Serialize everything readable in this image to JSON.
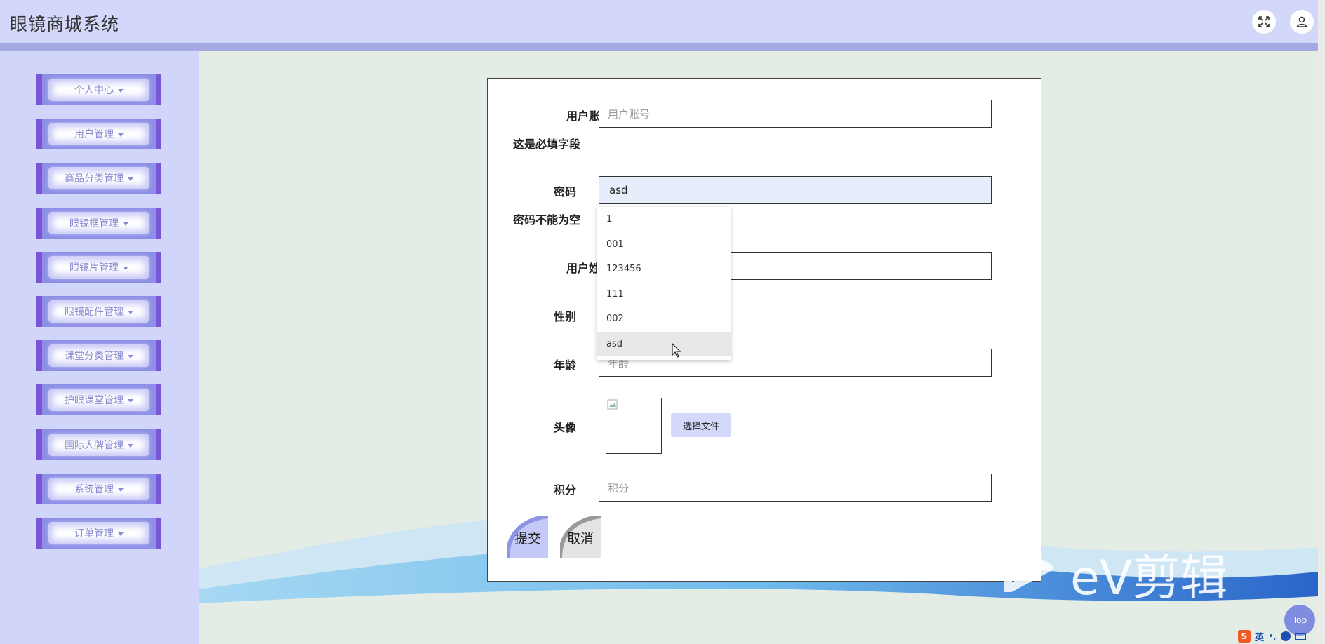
{
  "header": {
    "title": "眼镜商城系统"
  },
  "sidebar": {
    "items": [
      {
        "label": "个人中心"
      },
      {
        "label": "用户管理"
      },
      {
        "label": "商品分类管理"
      },
      {
        "label": "眼镜框管理"
      },
      {
        "label": "眼镜片管理"
      },
      {
        "label": "眼镜配件管理"
      },
      {
        "label": "课堂分类管理"
      },
      {
        "label": "护眼课堂管理"
      },
      {
        "label": "国际大牌管理"
      },
      {
        "label": "系统管理"
      },
      {
        "label": "订单管理"
      }
    ]
  },
  "form": {
    "account": {
      "label": "用户账号",
      "placeholder": "用户账号",
      "error": "这是必填字段"
    },
    "password": {
      "label": "密码",
      "value": "asd",
      "error": "密码不能为空"
    },
    "name": {
      "label": "用户姓名"
    },
    "gender": {
      "label": "性别"
    },
    "age": {
      "label": "年龄",
      "placeholder": "年龄"
    },
    "avatar": {
      "label": "头像",
      "file_button": "选择文件"
    },
    "points": {
      "label": "积分",
      "placeholder": "积分"
    },
    "submit_label": "提交",
    "cancel_label": "取消"
  },
  "autocomplete": {
    "options": [
      "1",
      "001",
      "123456",
      "111",
      "002",
      "asd"
    ],
    "selected_index": 5
  },
  "watermark": {
    "text": "eV剪辑"
  },
  "top_button": {
    "label": "Top"
  },
  "ime": {
    "lang": "英",
    "punct": "•,"
  },
  "colors": {
    "header_bg": "#d3d8fb",
    "sidebar_bg": "#d1d5f9",
    "menu_border": "#7a55d6",
    "accent": "#8a8cd2",
    "content_bg": "#e3ede6"
  }
}
